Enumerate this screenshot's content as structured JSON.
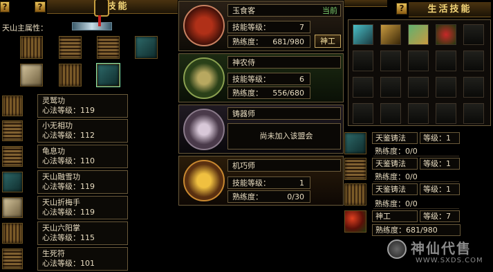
{
  "left_panel": {
    "title": "武技能",
    "attr_label": "天山主属性：",
    "martial_arts": [
      {
        "name": "灵鹫功",
        "level": "心法等级：119"
      },
      {
        "name": "小无相功",
        "level": "心法等级：112"
      },
      {
        "name": "龟息功",
        "level": "心法等级：110"
      },
      {
        "name": "天山融雪功",
        "level": "心法等级：119"
      },
      {
        "name": "天山折梅手",
        "level": "心法等级：119"
      },
      {
        "name": "天山六阳掌",
        "level": "心法等级：115"
      },
      {
        "name": "生死符",
        "level": "心法等级：101"
      }
    ]
  },
  "professions": [
    {
      "name": "玉食客",
      "badge": "当前",
      "skill_label": "技能等级：",
      "skill_value": "7",
      "prof_label": "熟练度：",
      "prof_value": "681/980",
      "button": "神工",
      "color": "#d04020"
    },
    {
      "name": "神农侍",
      "skill_label": "技能等级：",
      "skill_value": "6",
      "prof_label": "熟练度：",
      "prof_value": "556/680",
      "color": "#4a7a2a"
    },
    {
      "name": "铸器师",
      "status": "尚未加入该盟会",
      "color": "#7a6a8a"
    },
    {
      "name": "机巧师",
      "skill_label": "技能等级：",
      "skill_value": "1",
      "prof_label": "熟练度：",
      "prof_value": "0/30",
      "color": "#c87818"
    }
  ],
  "right_panel": {
    "title": "生活技能",
    "help": "?",
    "life_skills": [
      {
        "name": "天鉴铸法",
        "level": "等级：1",
        "prof": "熟练度：0/0"
      },
      {
        "name": "天鉴铸法",
        "level": "等级：1",
        "prof": "熟练度：0/0"
      },
      {
        "name": "天鉴铸法",
        "level": "等级：1",
        "prof": "熟练度：0/0"
      },
      {
        "name": "神工",
        "level": "等级：7",
        "prof": "熟练度：681/980"
      }
    ]
  },
  "watermark": {
    "brand": "神仙代售",
    "url": "WWW.SXDS.COM"
  }
}
